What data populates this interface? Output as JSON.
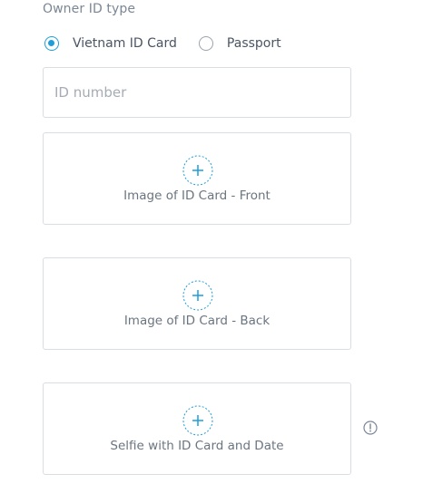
{
  "owner_id": {
    "section_label": "Owner ID type",
    "options": [
      {
        "label": "Vietnam ID Card",
        "selected": true
      },
      {
        "label": "Passport",
        "selected": false
      }
    ],
    "id_number_placeholder": "ID number"
  },
  "uploads": [
    {
      "label": "Image of ID Card - Front",
      "icon": "plus-icon"
    },
    {
      "label": "Image of ID Card - Back",
      "icon": "plus-icon"
    },
    {
      "label": "Selfie with ID Card and Date",
      "icon": "plus-icon"
    }
  ],
  "info_icon": "info-circle-icon",
  "colors": {
    "accent": "#1e9ed8",
    "border": "#d9dee3",
    "muted_text": "#7b8794"
  }
}
